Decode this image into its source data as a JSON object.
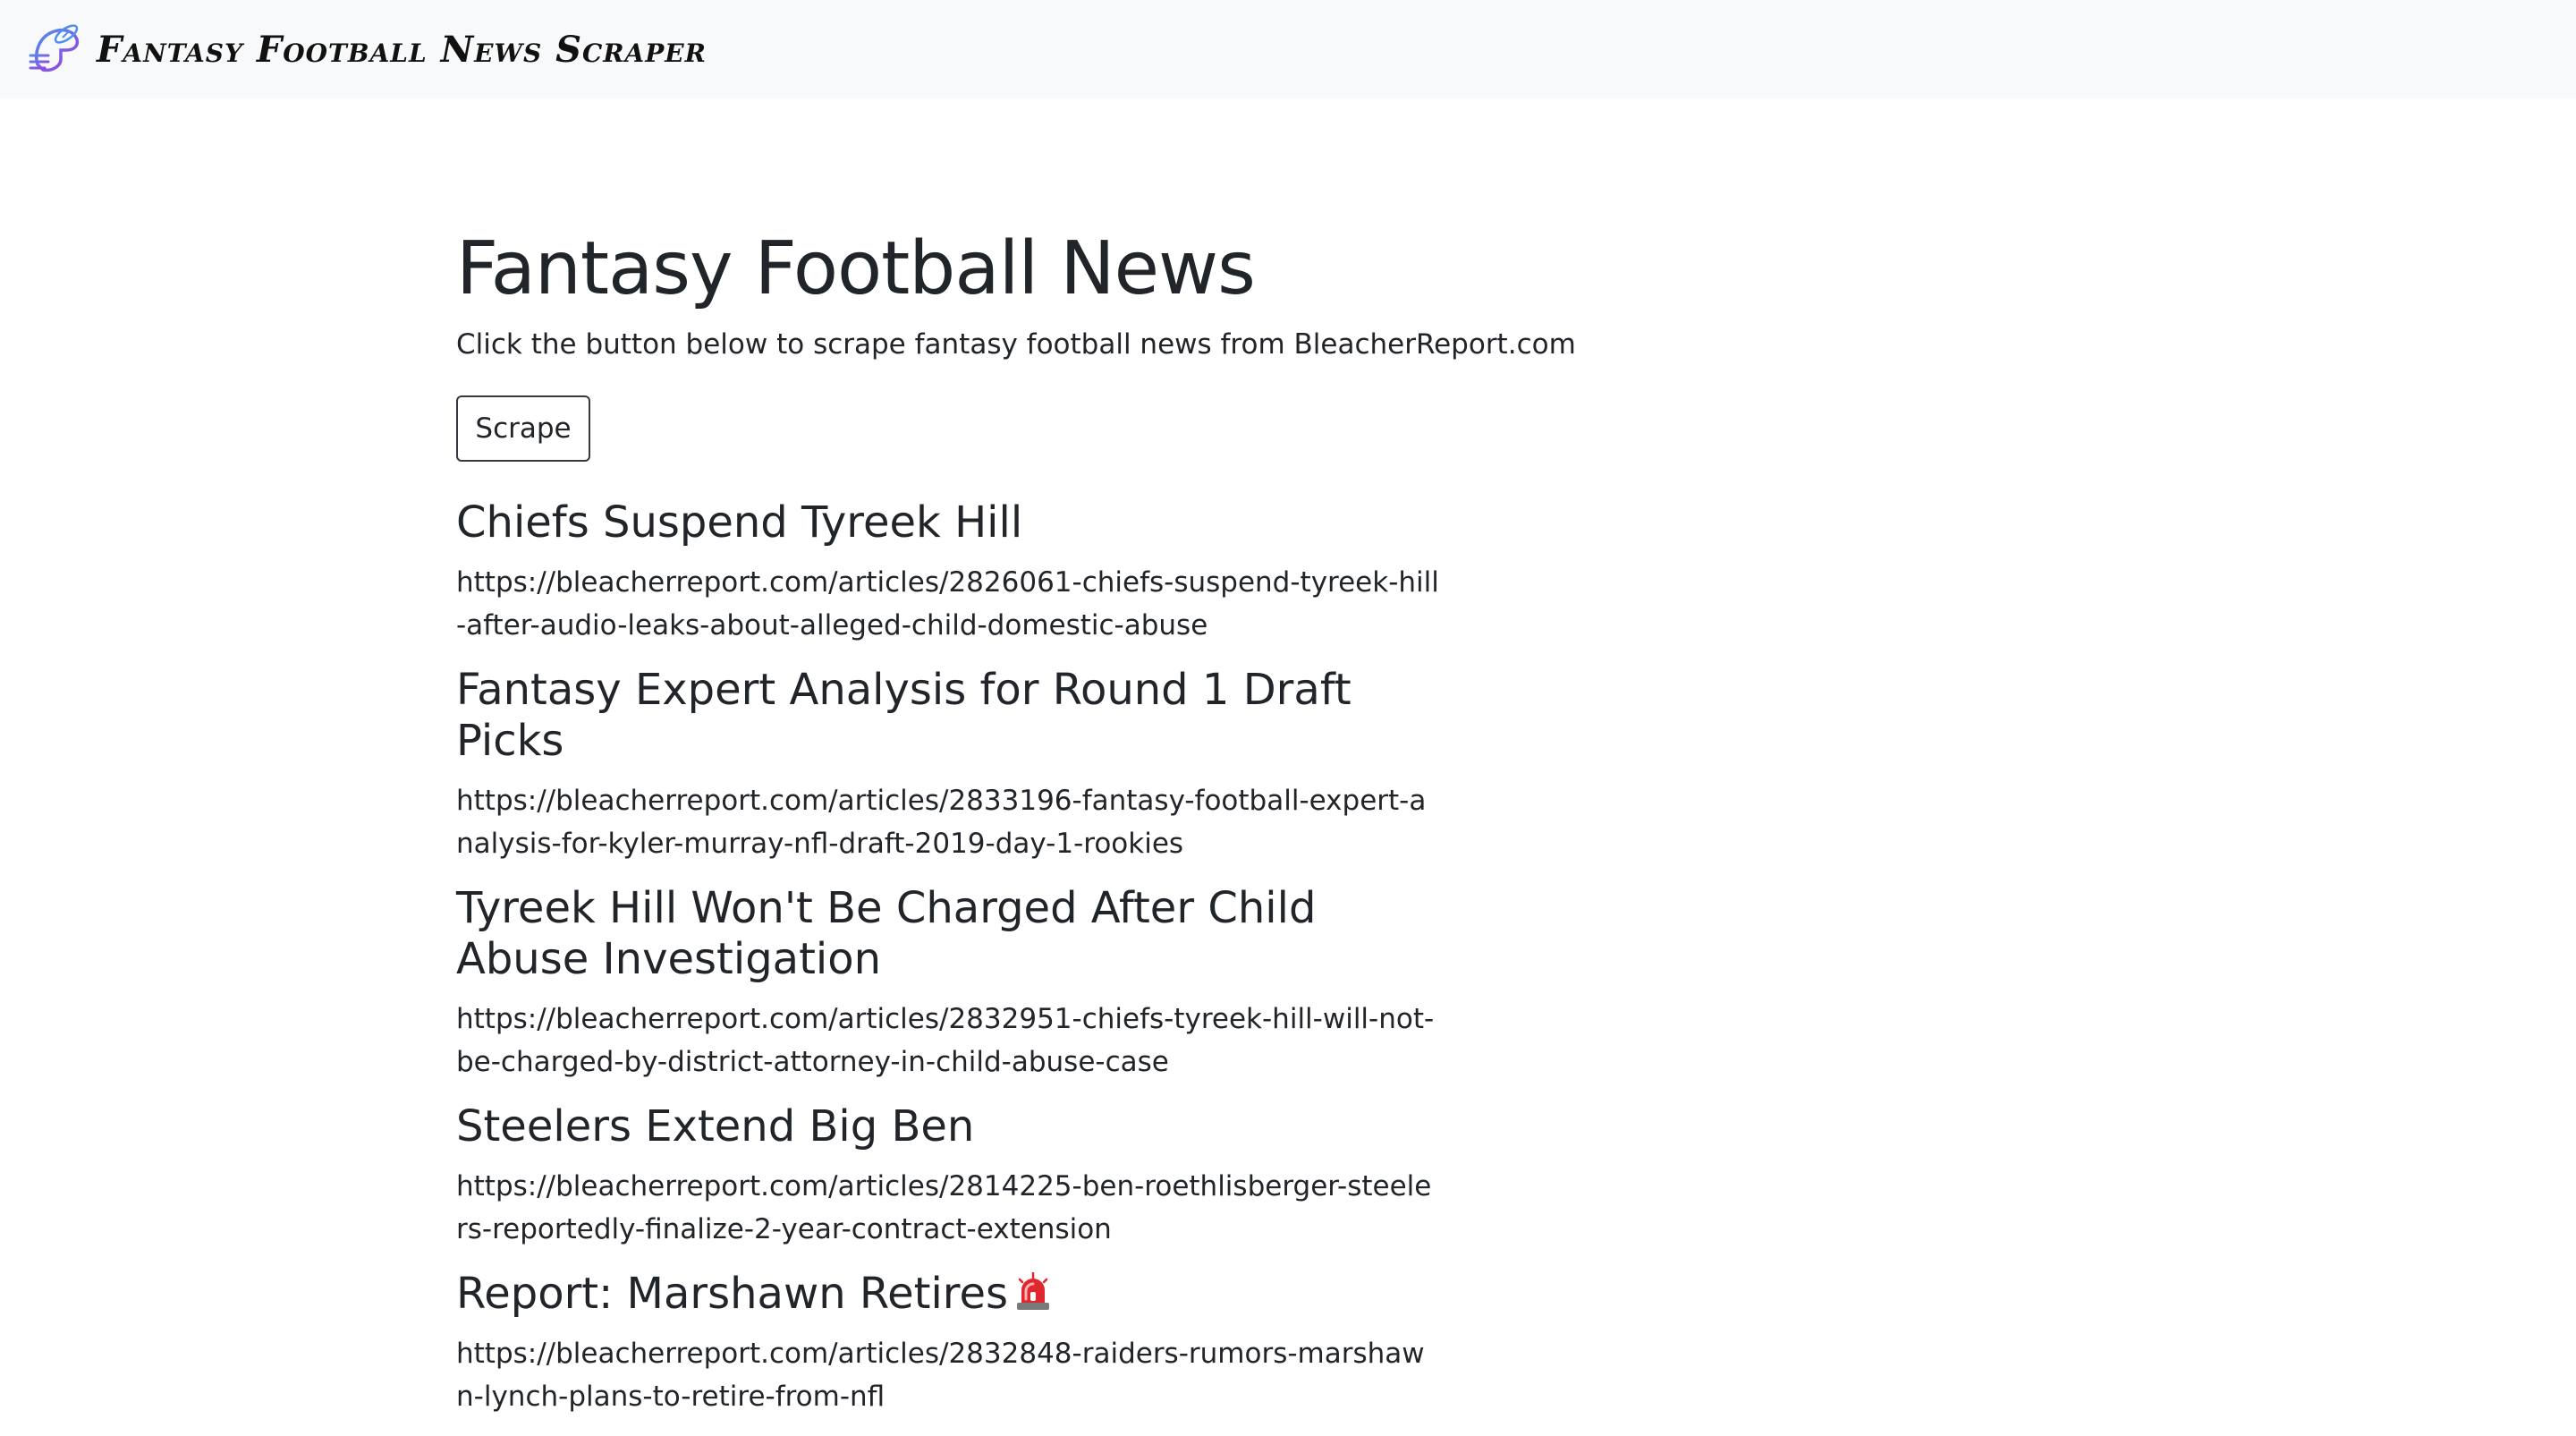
{
  "navbar": {
    "brand": "Fantasy Football News Scraper",
    "logo_icon": "football-helmet-icon"
  },
  "main": {
    "title": "Fantasy Football News",
    "subtitle": "Click the button below to scrape fantasy football news from BleacherReport.com",
    "scrape_button": "Scrape"
  },
  "articles": [
    {
      "title": "Chiefs Suspend Tyreek Hill",
      "url": "https://bleacherreport.com/articles/2826061-chiefs-suspend-tyreek-hill-after-audio-leaks-about-alleged-child-domestic-abuse"
    },
    {
      "title": "Fantasy Expert Analysis for Round 1 Draft Picks",
      "url": "https://bleacherreport.com/articles/2833196-fantasy-football-expert-analysis-for-kyler-murray-nfl-draft-2019-day-1-rookies"
    },
    {
      "title": "Tyreek Hill Won't Be Charged After Child Abuse Investigation",
      "url": "https://bleacherreport.com/articles/2832951-chiefs-tyreek-hill-will-not-be-charged-by-district-attorney-in-child-abuse-case"
    },
    {
      "title": "Steelers Extend Big Ben",
      "url": "https://bleacherreport.com/articles/2814225-ben-roethlisberger-steelers-reportedly-finalize-2-year-contract-extension"
    },
    {
      "title": "Report: Marshawn Retires",
      "title_icon": "siren-icon",
      "url": "https://bleacherreport.com/articles/2832848-raiders-rumors-marshawn-lynch-plans-to-retire-from-nfl"
    }
  ],
  "colors": {
    "navbar_bg": "#f8f9fa",
    "text": "#212529",
    "logo_accent": "#7b3fe4",
    "siren_red": "#e0262e"
  }
}
